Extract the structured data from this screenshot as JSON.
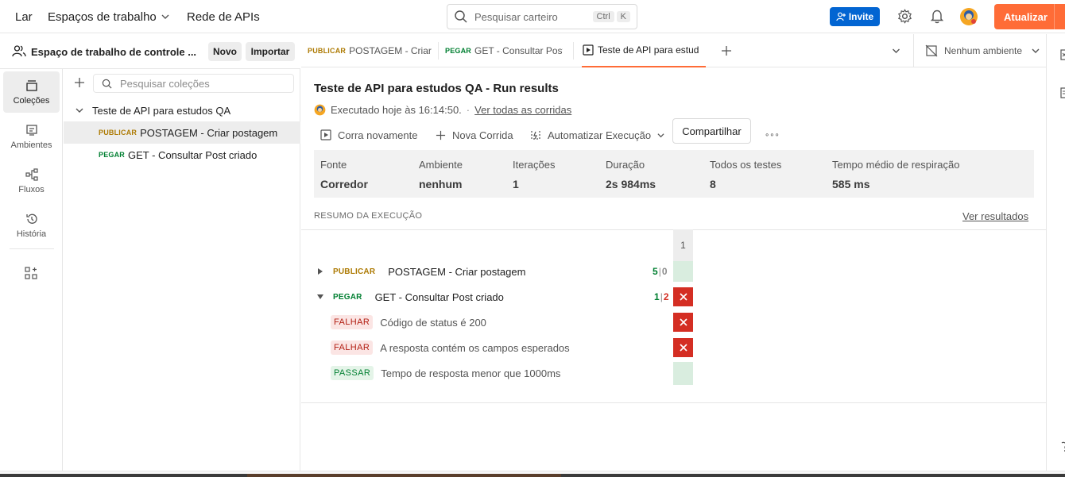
{
  "topbar": {
    "nav": [
      "Lar",
      "Espaços de trabalho",
      "Rede de APIs"
    ],
    "search_placeholder": "Pesquisar carteiro",
    "search_kbd": [
      "Ctrl",
      "K"
    ],
    "invite_label": "Invite",
    "upgrade_label": "Atualizar"
  },
  "rail": {
    "items": [
      {
        "label": "Coleções",
        "icon": "collections-icon",
        "active": true
      },
      {
        "label": "Ambientes",
        "icon": "environments-icon"
      },
      {
        "label": "Fluxos",
        "icon": "flows-icon"
      },
      {
        "label": "História",
        "icon": "history-icon"
      }
    ]
  },
  "sidebar": {
    "workspace_name": "Espaço de trabalho de controle ...",
    "new_label": "Novo",
    "import_label": "Importar",
    "search_placeholder": "Pesquisar coleções",
    "collection_name": "Teste de API para estudos QA",
    "requests": [
      {
        "method": "PUBLICAR",
        "name": "POSTAGEM - Criar postagem",
        "selected": true
      },
      {
        "method": "PEGAR",
        "name": "GET - Consultar Post criado"
      }
    ]
  },
  "tabs": [
    {
      "method": "PUBLICAR",
      "name": "POSTAGEM - Criar",
      "unsaved": true
    },
    {
      "method": "PEGAR",
      "name": "GET - Consultar Post c"
    },
    {
      "name": "Teste de API para estud",
      "active": true
    }
  ],
  "environment": {
    "label": "Nenhum ambiente"
  },
  "run": {
    "title": "Teste de API para estudos QA - Run results",
    "executed": "Executado hoje às 16:14:50.",
    "separator": "·",
    "see_all": "Ver todas as corridas",
    "actions": {
      "run_again": "Corra novamente",
      "new_run": "Nova Corrida",
      "automate": "Automatizar Execução",
      "share": "Compartilhar",
      "more": "∘∘∘"
    },
    "stats": [
      {
        "label": "Fonte",
        "value": "Corredor"
      },
      {
        "label": "Ambiente",
        "value": "nenhum"
      },
      {
        "label": "Iterações",
        "value": "1"
      },
      {
        "label": "Duração",
        "value": "2s 984ms"
      },
      {
        "label": "Todos os testes",
        "value": "8"
      },
      {
        "label": "Tempo médio de respiração",
        "value": "585 ms"
      }
    ],
    "summary_label": "RESUMO DA EXECUÇÃO",
    "view_results": "Ver resultados",
    "iteration_header": "1",
    "results": [
      {
        "method": "PUBLICAR",
        "name": "POSTAGEM - Criar postagem",
        "passed": "5",
        "failed": "0",
        "status": "pass",
        "expanded": false
      },
      {
        "method": "PEGAR",
        "name": "GET - Consultar Post criado",
        "passed": "1",
        "failed": "2",
        "status": "fail",
        "expanded": true,
        "tests": [
          {
            "result": "FALHAR",
            "name": "Código de status é 200",
            "status": "fail"
          },
          {
            "result": "FALHAR",
            "name": "A resposta contém os campos esperados",
            "status": "fail"
          },
          {
            "result": "PASSAR",
            "name": "Tempo de resposta menor que 1000ms",
            "status": "pass"
          }
        ]
      }
    ]
  },
  "colors": {
    "brand": "#ff6c37",
    "invite": "#0265d2",
    "fail": "#d42e23",
    "pass_cell": "#d9eddf",
    "post_method": "#ad7a03",
    "get_method": "#007f31"
  }
}
